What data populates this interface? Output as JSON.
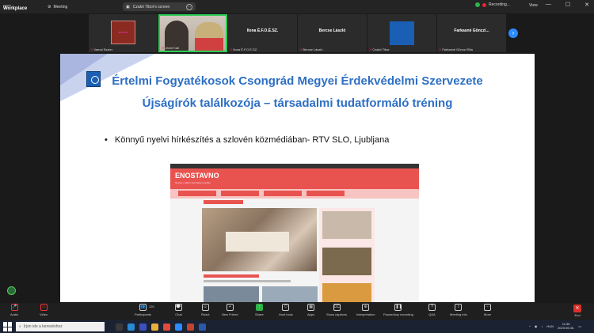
{
  "app": {
    "brand_top": "zoom",
    "brand_name": "Workplace",
    "meeting_label": "Meeting"
  },
  "share": {
    "label": "Czakó Tibor's screen",
    "more": "···"
  },
  "recording": {
    "label": "Recording..."
  },
  "view": {
    "label": "View"
  },
  "window_controls": [
    "—",
    "☐",
    "✕"
  ],
  "participants": [
    {
      "name": "Varnai Eszter",
      "type": "logo",
      "logo_text": "ÉFOÉSZ"
    },
    {
      "name": "Jáme Kati",
      "type": "video",
      "active": true
    },
    {
      "name": "Ilona É.F.O.É.SZ.",
      "center": "Ilona É.F.O.É.SZ."
    },
    {
      "name": "Bercse László",
      "center": "Bercse László"
    },
    {
      "name": "Czakó Tibor",
      "type": "ffo-logo"
    },
    {
      "name": "Farkasné Gönczi Rita",
      "center": "Farkasné Gönczi..."
    }
  ],
  "slide": {
    "title": "Értelmi Fogyatékosok Csongrád Megyei Érdekvédelmi Szervezete",
    "subtitle": "Újságírók találkozója – társadalmi tudatformáló tréning",
    "bullet_mark": "•",
    "bullet": "Könnyű nyelvi hírkészítés a szlovén közmédiában- RTV SLO, Ljubljana",
    "site_title": "ENOSTAVNO",
    "site_subtitle": "Novice v lahko razumljivem jeziku"
  },
  "toolbar": {
    "items": [
      {
        "label": "Audio",
        "icon": "mic-muted-icon",
        "glyph": "🎤"
      },
      {
        "label": "Video",
        "icon": "camera-off-icon",
        "glyph": "▭"
      },
      {
        "label": "Participants",
        "icon": "participants-icon",
        "glyph": "👥"
      },
      {
        "label": "Chat",
        "icon": "chat-icon",
        "glyph": "💬"
      },
      {
        "label": "React",
        "icon": "react-icon",
        "glyph": "☺"
      },
      {
        "label": "New Friend",
        "icon": "new-friend-icon",
        "glyph": "+"
      },
      {
        "label": "Share",
        "icon": "share-icon",
        "glyph": "↑"
      },
      {
        "label": "Host tools",
        "icon": "host-tools-icon",
        "glyph": "⛉"
      },
      {
        "label": "Apps",
        "icon": "apps-icon",
        "glyph": "▦"
      },
      {
        "label": "Show captions",
        "icon": "captions-icon",
        "glyph": "CC"
      },
      {
        "label": "Interpretation",
        "icon": "interpretation-icon",
        "glyph": "⊕"
      },
      {
        "label": "Pause/stop recording",
        "icon": "pause-recording-icon",
        "glyph": "❚❚"
      },
      {
        "label": "Q&A",
        "icon": "qa-icon",
        "glyph": "?"
      },
      {
        "label": "Meeting info",
        "icon": "info-icon",
        "glyph": "i"
      },
      {
        "label": "More",
        "icon": "more-icon",
        "glyph": "···"
      }
    ],
    "participants_count": "120",
    "end_label": "End"
  },
  "taskbar": {
    "search_placeholder": "Írjon ide a kereséshez",
    "language": "HUN",
    "time": "11:36",
    "date": "2023.06.06."
  }
}
